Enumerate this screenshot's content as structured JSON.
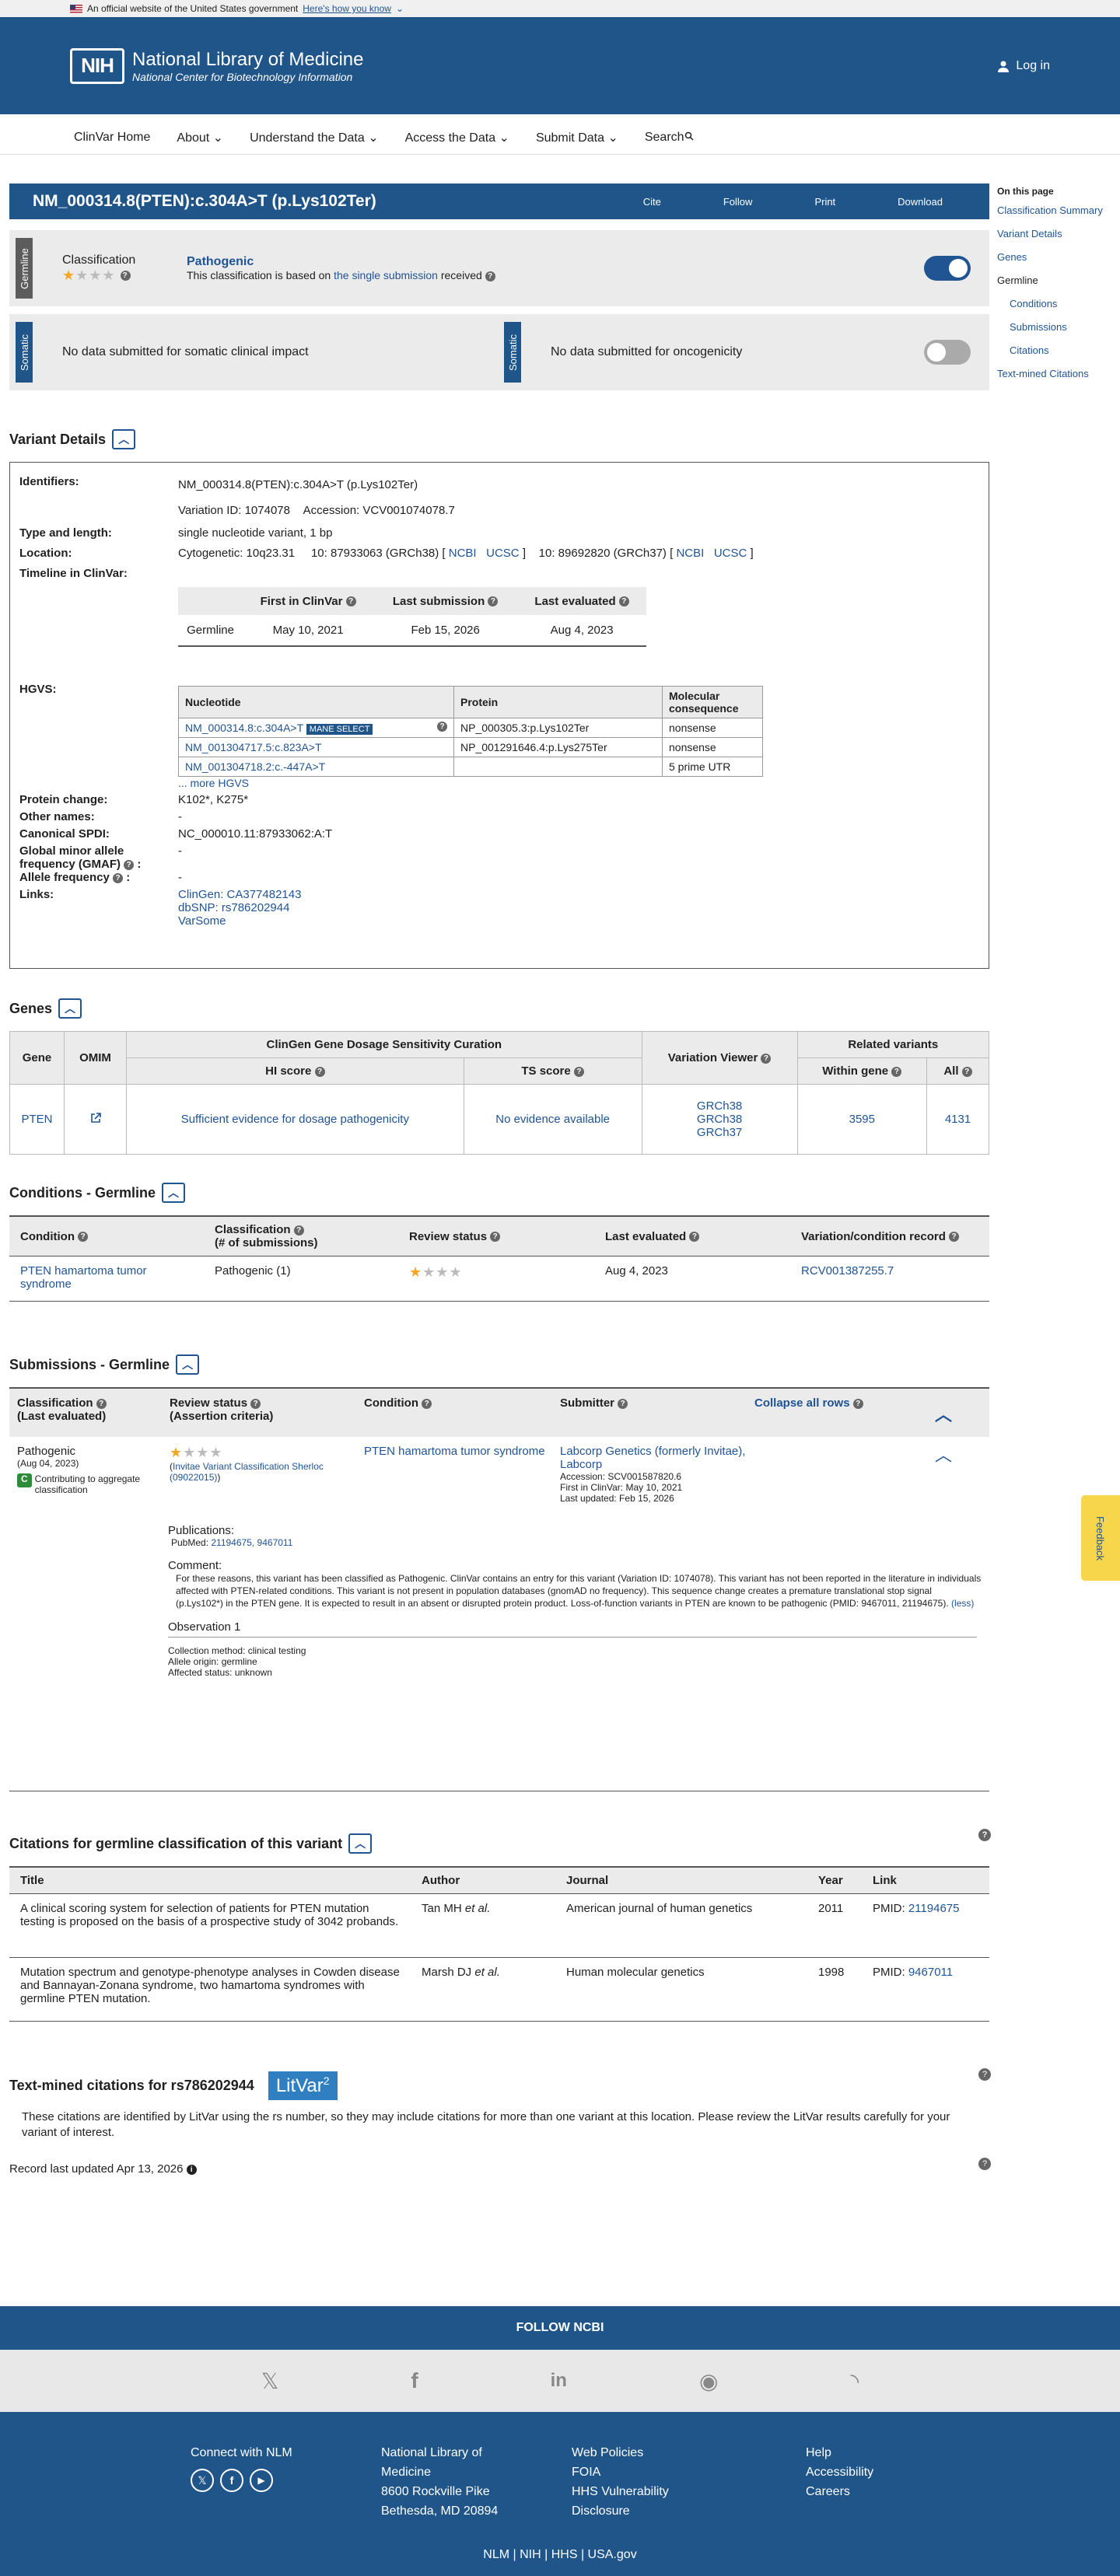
{
  "gov": {
    "text": "An official website of the United States government",
    "how": "Here's how you know"
  },
  "header": {
    "logo": "NIH",
    "title": "National Library of Medicine",
    "subtitle": "National Center for Biotechnology Information",
    "login": "Log in"
  },
  "nav": {
    "items": [
      "ClinVar Home",
      "About",
      "Understand the Data",
      "Access the Data",
      "Submit Data",
      "Search"
    ]
  },
  "sidebar": {
    "heading": "On this page",
    "items": [
      "Classification Summary",
      "Variant Details",
      "Genes"
    ],
    "group": "Germline",
    "sub": [
      "Conditions",
      "Submissions",
      "Citations"
    ],
    "last": "Text-mined Citations"
  },
  "title": {
    "text": "NM_000314.8(PTEN):c.304A>T (p.Lys102Ter)",
    "cite": "Cite",
    "follow": "Follow",
    "print": "Print",
    "download": "Download"
  },
  "germline": {
    "tab": "Germline",
    "label": "Classification",
    "value": "Pathogenic",
    "note_pre": "This classification is based on ",
    "note_link": "the single submission",
    "note_post": " received"
  },
  "somatic": {
    "tab": "Somatic",
    "clinical": "No data submitted for somatic clinical impact",
    "onco": "No data submitted for oncogenicity"
  },
  "variant": {
    "heading": "Variant Details",
    "identifiers_k": "Identifiers:",
    "identifiers": "NM_000314.8(PTEN):c.304A>T (p.Lys102Ter)",
    "vid": "Variation ID: 1074078",
    "acc": "Accession: VCV001074078.7",
    "type_k": "Type and length:",
    "type": "single nucleotide variant, 1 bp",
    "loc_k": "Location:",
    "cyto": "Cytogenetic: 10q23.31",
    "grch38": "10: 87933063 (GRCh38) [",
    "grch37": "10: 89692820 (GRCh37) [",
    "ncbi": "NCBI",
    "ucsc": "UCSC",
    "close": "]",
    "timeline_k": "Timeline in ClinVar:",
    "tl_h": [
      "First in ClinVar",
      "Last submission",
      "Last evaluated"
    ],
    "tl_row": [
      "Germline",
      "May 10, 2021",
      "Feb 15, 2026",
      "Aug 4, 2023"
    ],
    "hgvs_k": "HGVS:",
    "hgvs_h": [
      "Nucleotide",
      "Protein",
      "Molecular consequence"
    ],
    "mane": "MANE SELECT",
    "hgvs": [
      {
        "n": "NM_000314.8:c.304A>T",
        "p": "NP_000305.3:p.Lys102Ter",
        "c": "nonsense"
      },
      {
        "n": "NM_001304717.5:c.823A>T",
        "p": "NP_001291646.4:p.Lys275Ter",
        "c": "nonsense"
      },
      {
        "n": "NM_001304718.2:c.-447A>T",
        "p": "",
        "c": "5 prime UTR"
      }
    ],
    "more": "... more HGVS",
    "pc_k": "Protein change:",
    "pc": "K102*, K275*",
    "on_k": "Other names:",
    "on": "-",
    "spdi_k": "Canonical SPDI:",
    "spdi": "NC_000010.11:87933062:A:T",
    "gmaf_k1": "Global minor allele",
    "gmaf_k2": "frequency (GMAF)",
    "colon": ":",
    "gmaf": "-",
    "af_k": "Allele frequency",
    "af": "-",
    "links_k": "Links:",
    "links": [
      "ClinGen: CA377482143",
      "dbSNP: rs786202944",
      "VarSome"
    ]
  },
  "genes": {
    "heading": "Genes",
    "h1": [
      "Gene",
      "OMIM",
      "ClinGen Gene Dosage Sensitivity Curation",
      "Variation Viewer",
      "Related variants"
    ],
    "h2": [
      "HI score",
      "TS score",
      "Within gene",
      "All"
    ],
    "gene": "PTEN",
    "hi": "Sufficient evidence for dosage pathogenicity",
    "ts": "No evidence available",
    "vv": [
      "GRCh38",
      "GRCh38",
      "GRCh37"
    ],
    "within": "3595",
    "all": "4131"
  },
  "conditions": {
    "heading": "Conditions - Germline",
    "h": [
      "Condition",
      "Classification",
      "(# of submissions)",
      "Review status",
      "Last evaluated",
      "Variation/condition record"
    ],
    "cond": "PTEN hamartoma tumor syndrome",
    "cls": "Pathogenic (1)",
    "eval": "Aug 4, 2023",
    "rcv": "RCV001387255.7"
  },
  "submissions": {
    "heading": "Submissions - Germline",
    "h": [
      "Classification",
      "(Last evaluated)",
      "Review status",
      "(Assertion criteria)",
      "Condition",
      "Submitter",
      "Collapse all rows"
    ],
    "cls": "Pathogenic",
    "date": "(Aug 04, 2023)",
    "badge": "C",
    "contrib": "Contributing to aggregate classification",
    "crit_link": "Invitae Variant Classification Sherloc (09022015)",
    "cond": "PTEN hamartoma tumor syndrome",
    "sub": "Labcorp Genetics (formerly Invitae), Labcorp",
    "acc": "Accession: SCV001587820.6",
    "first": "First in ClinVar: May 10, 2021",
    "upd": "Last updated: Feb 15, 2026",
    "pub_k": "Publications:",
    "pub_pre": "PubMed: ",
    "pub_links": "21194675, 9467011",
    "comm_k": "Comment:",
    "comment": "For these reasons, this variant has been classified as Pathogenic. ClinVar contains an entry for this variant (Variation ID: 1074078). This variant has not been reported in the literature in individuals affected with PTEN-related conditions. This variant is not present in population databases (gnomAD no frequency). This sequence change creates a premature translational stop signal (p.Lys102*) in the PTEN gene. It is expected to result in an absent or disrupted protein product. Loss-of-function variants in PTEN are known to be pathogenic (PMID: 9467011, 21194675).",
    "less": "(less)",
    "obs": "Observation 1",
    "method": "Collection method: clinical testing",
    "origin": "Allele origin: germline",
    "status": "Affected status: unknown"
  },
  "citations": {
    "heading": "Citations for germline classification of this variant",
    "h": [
      "Title",
      "Author",
      "Journal",
      "Year",
      "Link"
    ],
    "rows": [
      {
        "t": "A clinical scoring system for selection of patients for PTEN mutation testing is proposed on the basis of a prospective study of 3042 probands.",
        "a": "Tan MH",
        "j": "American journal of human genetics",
        "y": "2011",
        "l": "21194675"
      },
      {
        "t": "Mutation spectrum and genotype-phenotype analyses in Cowden disease and Bannayan-Zonana syndrome, two hamartoma syndromes with germline PTEN mutation.",
        "a": "Marsh DJ",
        "j": "Human molecular genetics",
        "y": "1998",
        "l": "9467011"
      }
    ],
    "etal": "et al.",
    "pmid": "PMID: "
  },
  "textmined": {
    "heading": "Text-mined citations for rs786202944",
    "litvar": "LitVar",
    "sup": "2",
    "body": "These citations are identified by LitVar using the rs number, so they may include citations for more than one variant at this location. Please review the LitVar results carefully for your variant of interest."
  },
  "updated": "Record last updated Apr 13, 2026",
  "feedback": "Feedback",
  "footer": {
    "follow": "FOLLOW NCBI",
    "connect": "Connect with NLM",
    "nlm": [
      "National Library of",
      "Medicine",
      "8600 Rockville Pike",
      "Bethesda, MD 20894"
    ],
    "c3": [
      "Web Policies",
      "FOIA",
      "HHS Vulnerability",
      "Disclosure"
    ],
    "c4": [
      "Help",
      "Accessibility",
      "Careers"
    ],
    "bottom": "NLM | NIH | HHS | USA.gov"
  }
}
